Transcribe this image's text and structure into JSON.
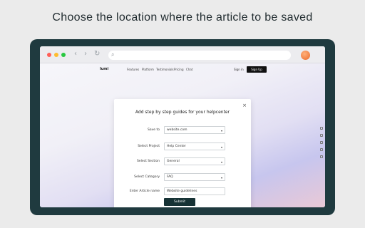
{
  "headline": "Choose the location where the article to be saved",
  "browser": {
    "traffic_lights": [
      "#ff5f57",
      "#febc2e",
      "#28c840"
    ],
    "back_label": "‹",
    "forward_label": "›",
    "reload_label": "↻",
    "search_icon": "⌕"
  },
  "site": {
    "logo": "lumi",
    "nav": [
      "Features",
      "Platform",
      "Testimonials",
      "Pricing",
      "Chat"
    ],
    "login": "Sign in",
    "signup": "Sign Up"
  },
  "modal": {
    "title": "Add step by step guides for your helpcenter",
    "close": "×",
    "fields": [
      {
        "label": "Save to",
        "value": "website.com",
        "type": "select"
      },
      {
        "label": "Select Project",
        "value": "Help Center",
        "type": "select"
      },
      {
        "label": "Select Section",
        "value": "General",
        "type": "select"
      },
      {
        "label": "Select Category",
        "value": "FAQ",
        "type": "select"
      },
      {
        "label": "Enter Article name",
        "value": "Website guidelines",
        "type": "input"
      }
    ],
    "submit": "Submit",
    "caret": "▾"
  },
  "colors": {
    "frame": "#1f3a3f",
    "submit_bg": "#163235",
    "avatar": "#ea6a2a"
  }
}
